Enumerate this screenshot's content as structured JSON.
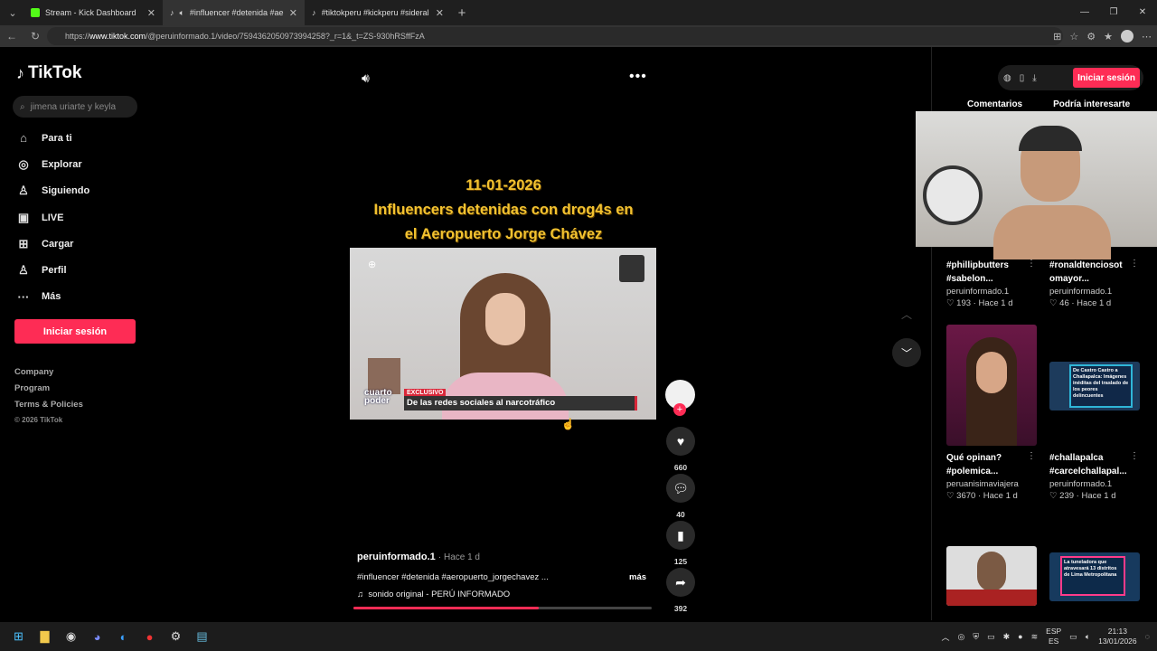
{
  "browser": {
    "tabs": [
      {
        "title": "Stream - Kick Dashboard",
        "fav_color": "#53fc18",
        "active": false
      },
      {
        "title": "#influencer #detenida #aerop",
        "fav_color": "#ffffff",
        "active": true
      },
      {
        "title": "#tiktokperu #kickperu #sideral #s",
        "fav_color": "#ffffff",
        "active": false
      }
    ],
    "url_prefix": "https://",
    "url_domain": "www.tiktok.com",
    "url_rest": "/@peruinformado.1/video/7594362050973994258?_r=1&_t=ZS-930hRSffFzA"
  },
  "sidebar": {
    "brand": "TikTok",
    "search_placeholder": "jimena uriarte y keyla",
    "items": [
      {
        "label": "Para ti",
        "icon": "home-icon",
        "glyph": "⌂"
      },
      {
        "label": "Explorar",
        "icon": "compass-icon",
        "glyph": "◎"
      },
      {
        "label": "Siguiendo",
        "icon": "user-follow-icon",
        "glyph": "♙"
      },
      {
        "label": "LIVE",
        "icon": "live-icon",
        "glyph": "▣"
      },
      {
        "label": "Cargar",
        "icon": "upload-icon",
        "glyph": "⊞"
      },
      {
        "label": "Perfil",
        "icon": "profile-icon",
        "glyph": "♙"
      },
      {
        "label": "Más",
        "icon": "more-icon",
        "glyph": "···"
      }
    ],
    "login_label": "Iniciar sesión",
    "footer": [
      "Company",
      "Program",
      "Terms & Policies"
    ],
    "copyright": "© 2026 TikTok"
  },
  "video": {
    "title_line1": "11-01-2026",
    "title_line2": "Influencers detenidas con drog4s en",
    "title_line3": "el Aeropuerto Jorge Chávez",
    "tag_label": "EXCLUSIVO",
    "lower_third": "De las redes sociales al narcotráfico",
    "channel_line1": "cuarto",
    "channel_line2": "poder",
    "author": "peruinformado.1",
    "posted": "· Hace 1 d",
    "description": "#influencer #detenida #aeropuerto_jorgechavez ...",
    "more_label": "más",
    "sound": "sonido original - PERÚ INFORMADO",
    "progress": 0.62
  },
  "actions": {
    "likes": "660",
    "comments": "40",
    "saves": "125",
    "shares": "392"
  },
  "right_panel": {
    "login_label": "Iniciar sesión",
    "tab_comments": "Comentarios",
    "tab_interest": "Podría interesarte",
    "cards": [
      {
        "title_l1": "#phillipbutters",
        "title_l2": "#sabelon...",
        "author": "peruinformado.1",
        "stats": "193 · Hace 1 d"
      },
      {
        "title_l1": "#ronaldtenciosot",
        "title_l2": "omayor...",
        "author": "peruinformado.1",
        "stats": "46 · Hace 1 d"
      },
      {
        "title_l1": "Qué opinan?",
        "title_l2": "#polemica...",
        "author": "peruanisimaviajera",
        "stats": "3670 · Hace 1 d"
      },
      {
        "title_l1": "#challapalca",
        "title_l2": "#carcelchallapal...",
        "author": "peruinformado.1",
        "stats": "239 · Hace 1 d"
      }
    ],
    "thumb_text_1": "De Castro Castro a Challapalca: Imágenes inéditas del traslado de los peores delincuentes",
    "thumb_text_2": "La tuneladora que atravesará 13 distritos de Lima Metropolitana"
  },
  "taskbar": {
    "lang_1": "ESP",
    "lang_2": "ES",
    "time": "21:13",
    "date": "13/01/2026"
  },
  "colors": {
    "accent": "#fe2c55",
    "title_yellow": "#f2c230"
  }
}
